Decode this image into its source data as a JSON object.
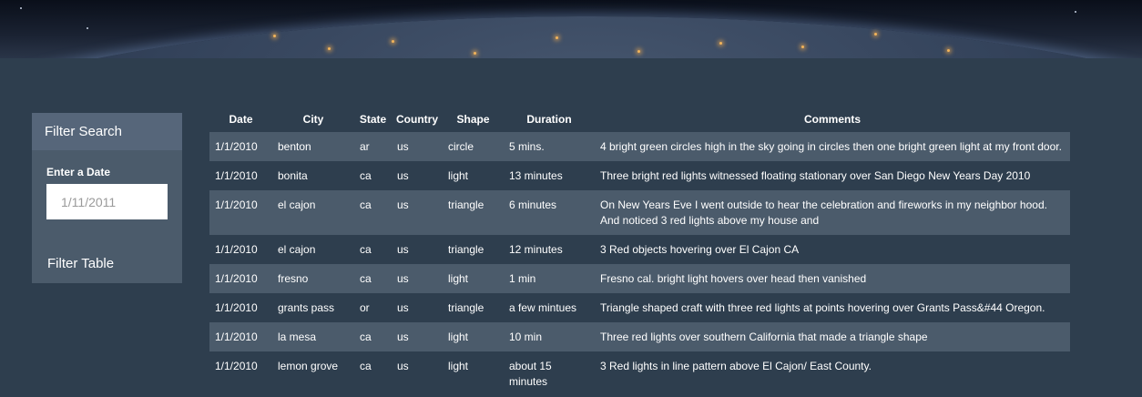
{
  "filter": {
    "title": "Filter Search",
    "date_label": "Enter a Date",
    "date_placeholder": "1/11/2011",
    "button_label": "Filter Table"
  },
  "table": {
    "headers": [
      "Date",
      "City",
      "State",
      "Country",
      "Shape",
      "Duration",
      "Comments"
    ],
    "rows": [
      [
        "1/1/2010",
        "benton",
        "ar",
        "us",
        "circle",
        "5 mins.",
        "4 bright green circles high in the sky going in circles then one bright green light at my front door."
      ],
      [
        "1/1/2010",
        "bonita",
        "ca",
        "us",
        "light",
        "13 minutes",
        "Three bright red lights witnessed floating stationary over San Diego New Years Day 2010"
      ],
      [
        "1/1/2010",
        "el cajon",
        "ca",
        "us",
        "triangle",
        "6 minutes",
        "On New Years Eve I went outside to hear the celebration and fireworks in my neighbor hood. And noticed 3 red lights above my house and"
      ],
      [
        "1/1/2010",
        "el cajon",
        "ca",
        "us",
        "triangle",
        "12 minutes",
        "3 Red objects hovering over El Cajon CA"
      ],
      [
        "1/1/2010",
        "fresno",
        "ca",
        "us",
        "light",
        "1 min",
        "Fresno cal. bright light hovers over head then vanished"
      ],
      [
        "1/1/2010",
        "grants pass",
        "or",
        "us",
        "triangle",
        "a few mintues",
        "Triangle shaped craft with three red lights at points hovering over Grants Pass&#44 Oregon."
      ],
      [
        "1/1/2010",
        "la mesa",
        "ca",
        "us",
        "light",
        "10 min",
        "Three red lights over southern California that made a triangle shape"
      ],
      [
        "1/1/2010",
        "lemon grove",
        "ca",
        "us",
        "light",
        "about 15 minutes",
        "3 Red lights in line pattern above El Cajon/ East County."
      ]
    ]
  }
}
